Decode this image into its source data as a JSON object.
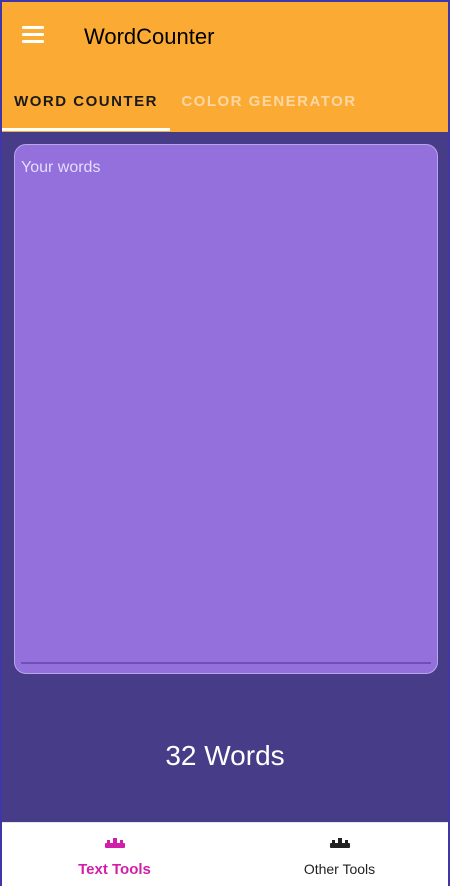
{
  "appbar": {
    "title": "WordCounter",
    "color": "#fbab33"
  },
  "tabs": [
    {
      "label": "WORD COUNTER",
      "active": true
    },
    {
      "label": "COLOR GENERATOR",
      "active": false
    }
  ],
  "editor": {
    "placeholder": "Your words",
    "value": ""
  },
  "word_count": {
    "text": "32 Words"
  },
  "bottom_nav": {
    "items": [
      {
        "label": "Text Tools",
        "icon": "tools-icon",
        "active": true,
        "color": "#d11fa8"
      },
      {
        "label": "Other Tools",
        "icon": "tools-icon",
        "active": false,
        "color": "#222222"
      }
    ]
  }
}
